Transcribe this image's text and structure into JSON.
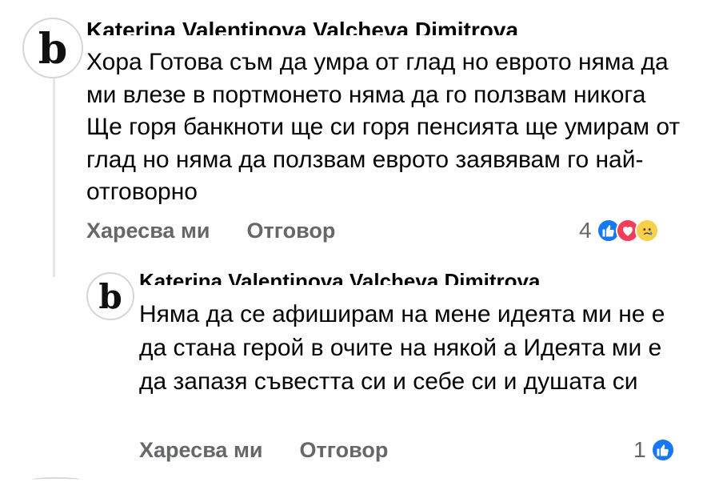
{
  "comments": [
    {
      "avatar_letter": "b",
      "author": "Katerina Valentinova Valcheva Dimitrova",
      "text": "Хора Готова съм да умра от глад но еврото няма да ми влезе в портмонето няма да го ползвам никога Ще горя банкноти ще си горя пенсията ще умирам от глад но няма да ползвам еврото заявявам го най-отговорно",
      "like_label": "Харесва ми",
      "reply_label": "Отговор",
      "reaction_count": "4",
      "reactions": [
        "like-icon",
        "love-icon",
        "sad-icon"
      ]
    },
    {
      "avatar_letter": "b",
      "author": "Katerina Valentinova Valcheva Dimitrova",
      "text": "Няма да се афиширам на мене идеята ми не е да стана герой в очите на някой а Идеята ми е да запазя съвестта си и себе си и душата си",
      "like_label": "Харесва ми",
      "reply_label": "Отговор",
      "reaction_count": "1",
      "reactions": [
        "like-icon"
      ]
    }
  ],
  "colors": {
    "like": "#1877f2",
    "love": "#f33e58",
    "sad": "#f7d04a",
    "meta_text": "#65676b"
  }
}
